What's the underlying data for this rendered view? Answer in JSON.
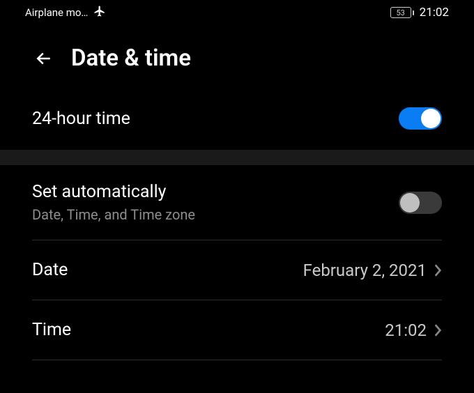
{
  "status": {
    "mode_label": "Airplane mo…",
    "battery_percent": "53",
    "clock": "21:02"
  },
  "header": {
    "title": "Date & time"
  },
  "rows": {
    "twenty_four_hour": {
      "label": "24-hour time",
      "enabled": true
    },
    "set_automatically": {
      "label": "Set automatically",
      "subtitle": "Date, Time, and Time zone",
      "enabled": false
    },
    "date": {
      "label": "Date",
      "value": "February 2, 2021"
    },
    "time": {
      "label": "Time",
      "value": "21:02"
    }
  }
}
